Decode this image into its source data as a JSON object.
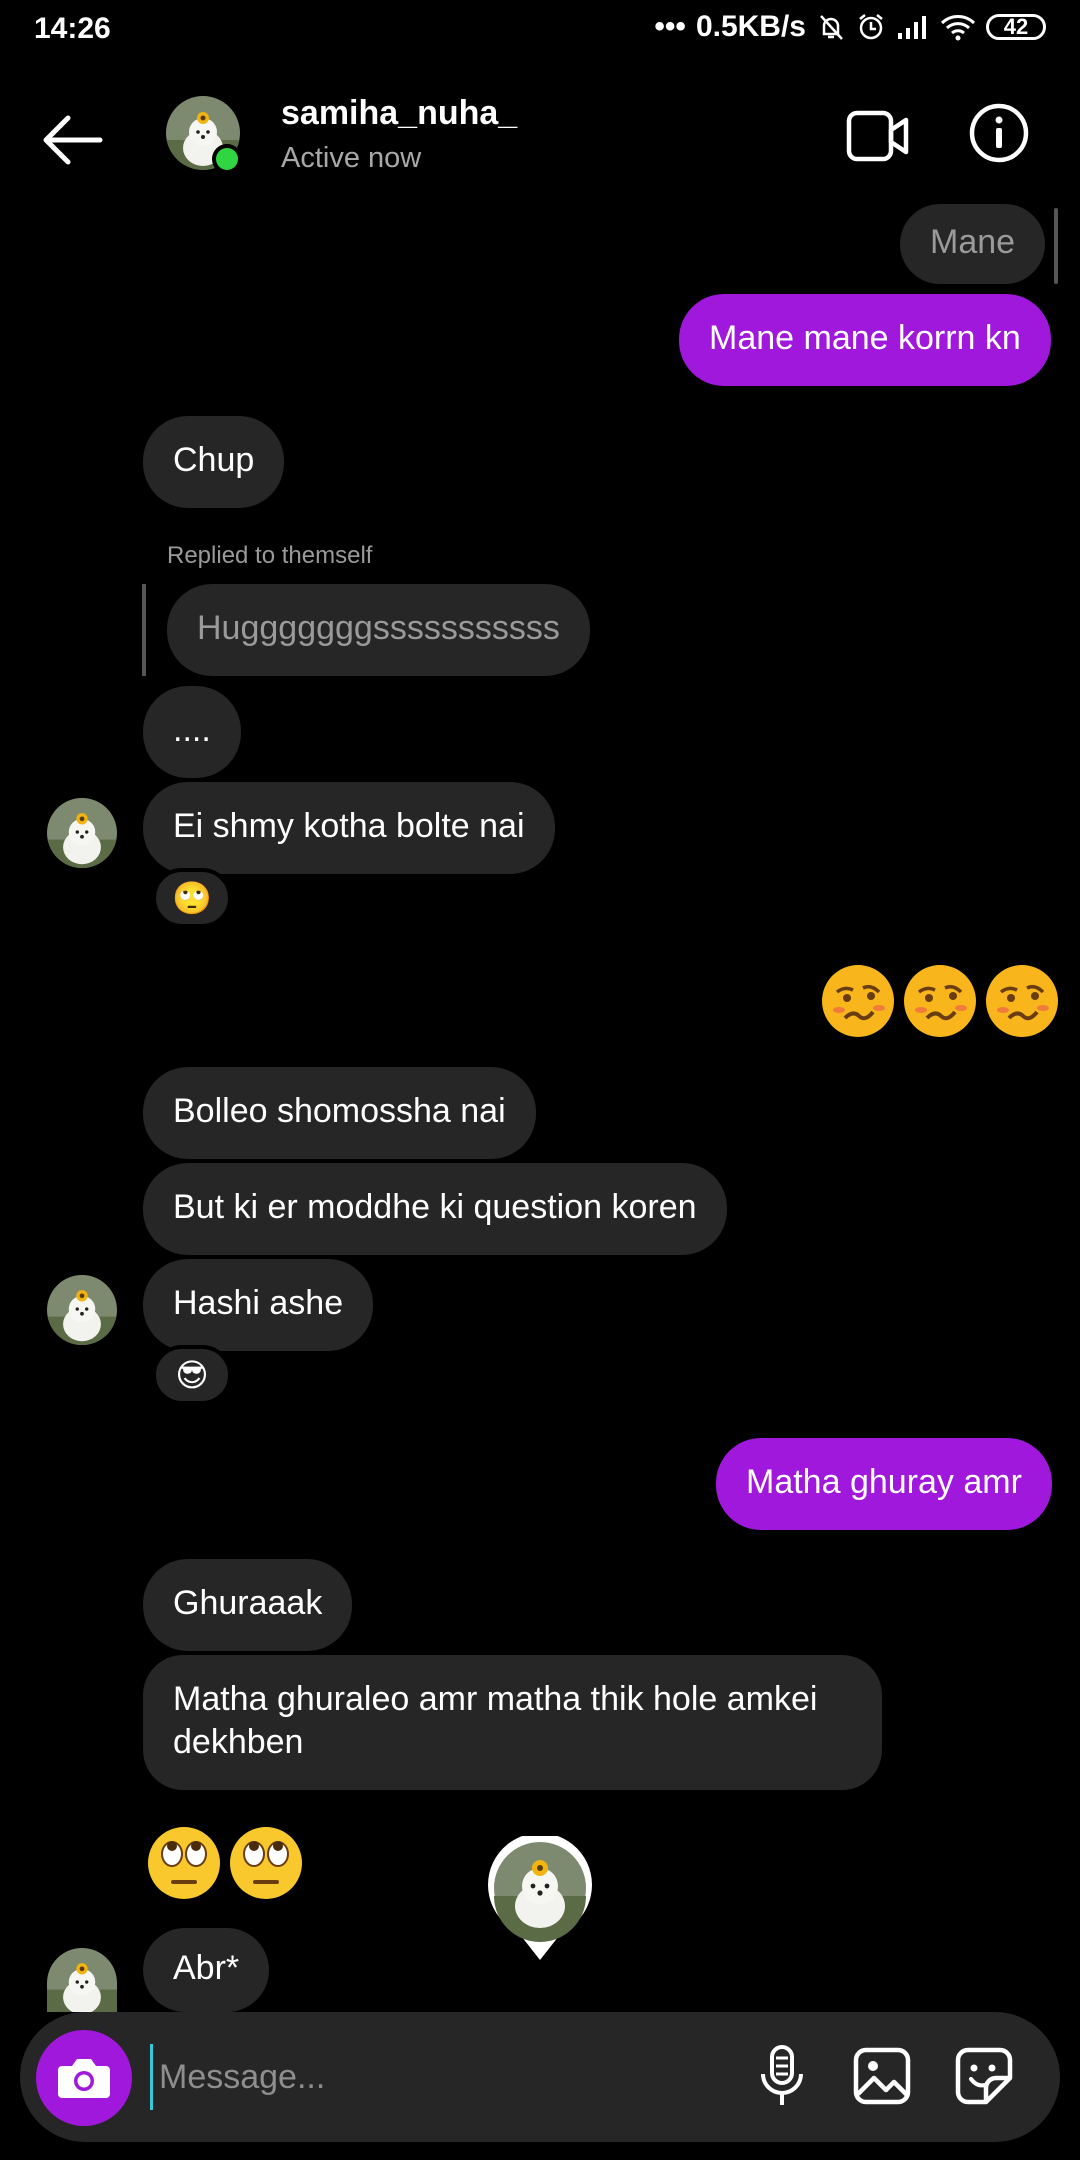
{
  "status_bar": {
    "time": "14:26",
    "speed": "0.5KB/s",
    "battery": "42"
  },
  "header": {
    "name": "samiha_nuha_",
    "status": "Active now"
  },
  "messages": [
    {
      "text": "Mane"
    },
    {
      "text": "Mane mane korrn kn"
    },
    {
      "text": "Chup"
    },
    {
      "text": "Replied to themself"
    },
    {
      "text": "Hugggggggsssssssssss"
    },
    {
      "text": "...."
    },
    {
      "text": "Ei shmy kotha bolte nai"
    },
    {
      "text": "Bolleo shomossha nai"
    },
    {
      "text": "But ki er moddhe ki question koren"
    },
    {
      "text": "Hashi ashe"
    },
    {
      "text": "Matha ghuray amr"
    },
    {
      "text": "Ghuraaak"
    },
    {
      "text": "Matha ghuraleo amr matha thik hole amkei dekhben"
    },
    {
      "text": "Abr*"
    }
  ],
  "reactions": {
    "eye_roll": "🙄",
    "sunglasses": "😎"
  },
  "composer": {
    "placeholder": "Message..."
  },
  "icons": [
    "back-arrow-icon",
    "video-call-icon",
    "info-icon",
    "camera-icon",
    "microphone-icon",
    "gallery-icon",
    "sticker-icon"
  ],
  "colors": {
    "accent": "#a018dc",
    "incoming_bubble": "#262626",
    "online": "#2fd642"
  }
}
